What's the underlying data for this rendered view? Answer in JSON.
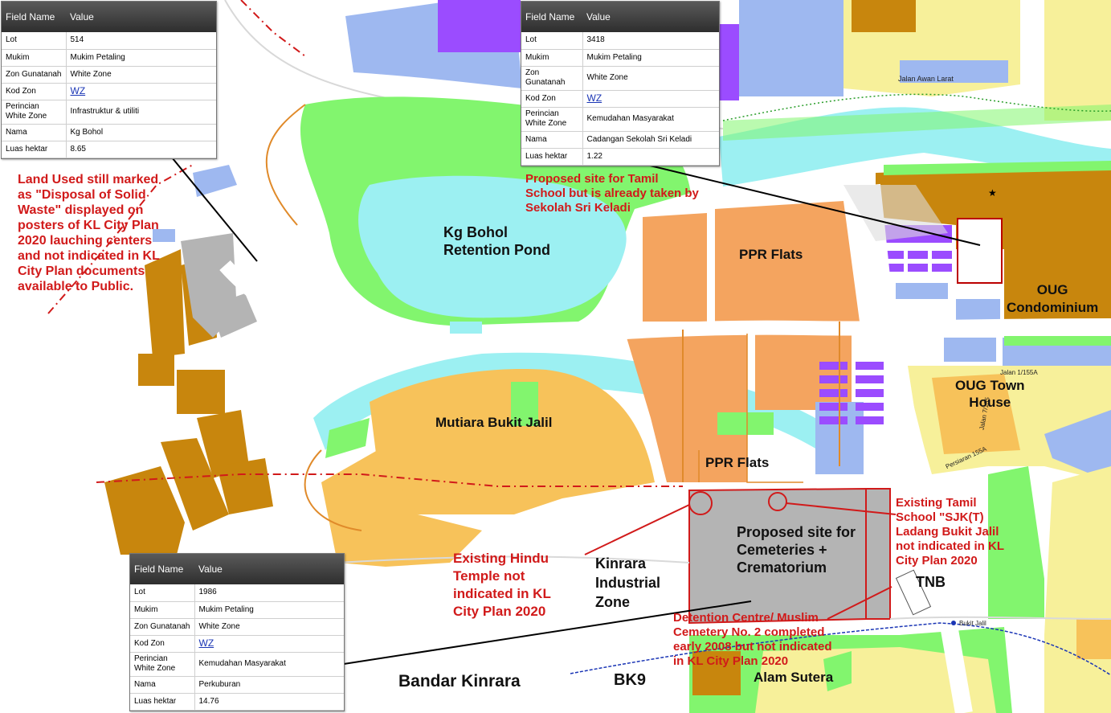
{
  "colors": {
    "residential_low": "#f7f09a",
    "residential_mid": "#f7c25a",
    "flats": "#f4a45f",
    "brown": "#c8860d",
    "water": "#9cf0f2",
    "green": "#82f56e",
    "blue": "#9eb8f0",
    "purple": "#9b4cff",
    "grey": "#b4b4b4",
    "annotation_red": "#d11a1a"
  },
  "panels": {
    "header_field": "Field Name",
    "header_value": "Value",
    "p1": {
      "rows": [
        {
          "k": "Lot",
          "v": "514"
        },
        {
          "k": "Mukim",
          "v": "Mukim Petaling"
        },
        {
          "k": "Zon Gunatanah",
          "v": "White Zone"
        },
        {
          "k": "Kod Zon",
          "v": "WZ"
        },
        {
          "k": "Perincian White Zone",
          "v": "Infrastruktur & utiliti"
        },
        {
          "k": "Nama",
          "v": "Kg Bohol"
        },
        {
          "k": "Luas hektar",
          "v": "8.65"
        }
      ]
    },
    "p2": {
      "rows": [
        {
          "k": "Lot",
          "v": "3418"
        },
        {
          "k": "Mukim",
          "v": "Mukim Petaling"
        },
        {
          "k": "Zon Gunatanah",
          "v": "White Zone"
        },
        {
          "k": "Kod Zon",
          "v": "WZ"
        },
        {
          "k": "Perincian White Zone",
          "v": "Kemudahan Masyarakat"
        },
        {
          "k": "Nama",
          "v": "Cadangan Sekolah Sri Keladi"
        },
        {
          "k": "Luas hektar",
          "v": "1.22"
        }
      ]
    },
    "p3": {
      "rows": [
        {
          "k": "Lot",
          "v": "1986"
        },
        {
          "k": "Mukim",
          "v": "Mukim Petaling"
        },
        {
          "k": "Zon Gunatanah",
          "v": "White Zone"
        },
        {
          "k": "Kod Zon",
          "v": "WZ"
        },
        {
          "k": "Perincian White Zone",
          "v": "Kemudahan Masyarakat"
        },
        {
          "k": "Nama",
          "v": "Perkuburan"
        },
        {
          "k": "Luas hektar",
          "v": "14.76"
        }
      ]
    }
  },
  "annotations": {
    "solid_waste": "Land Used still marked\nas \"Disposal of Solid\nWaste\" displayed on\nposters of KL City Plan\n2020 lauching centers\nand not indicated in KL\nCity Plan documents\navailable to Public.",
    "tamil_proposed": "Proposed site for Tamil\nSchool but is already taken by\nSekolah Sri Keladi",
    "hindu_temple": "Existing Hindu\nTemple not\nindicated in KL\nCity Plan 2020",
    "tamil_existing": "Existing Tamil\nSchool \"SJK(T)\nLadang Bukit Jalil\nnot indicated in KL\nCity Plan 2020",
    "detention": "Detention Centre/ Muslim\nCemetery No. 2 completed\nearly 2008 but not indicated\nin KL City Plan 2020"
  },
  "places": {
    "kg_bohol": "Kg Bohol\nRetention Pond",
    "ppr_top": "PPR Flats",
    "ppr_bottom": "PPR Flats",
    "oug_condo": "OUG\nCondominium",
    "oug_town": "OUG Town\nHouse",
    "mutiara": "Mutiara Bukit Jalil",
    "cemeteries": "Proposed site for\nCemeteries +\nCrematorium",
    "kinrara": "Kinrara\nIndustrial\nZone",
    "tnb": "TNB",
    "bandar_kinrara": "Bandar Kinrara",
    "bk9": "BK9",
    "alam_sutera": "Alam Sutera"
  },
  "streets": {
    "awan_larat": "Jalan Awan Larat",
    "j1_155a": "Jalan 1/155A",
    "j7_155": "Jalan 7/155",
    "persiaran_155a": "Persiaran 155A",
    "bukit_jalil": "Bukit Jalil"
  }
}
